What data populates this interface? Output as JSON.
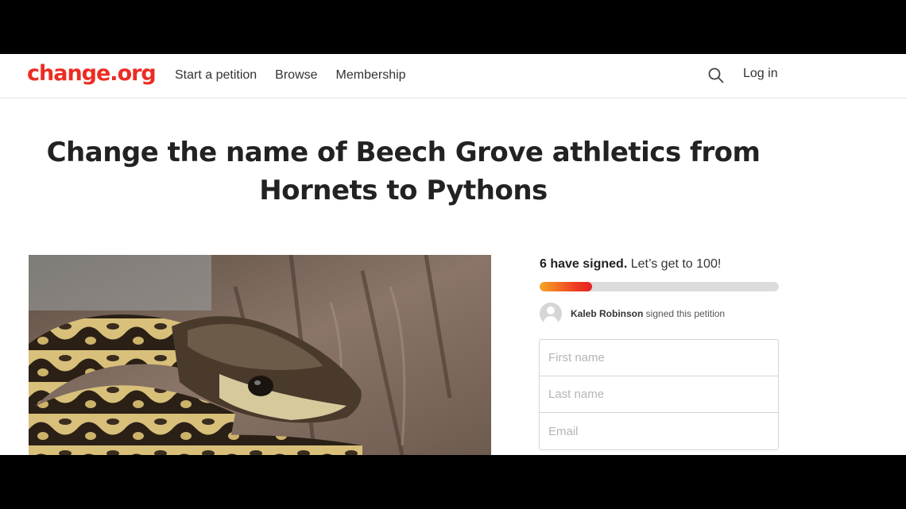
{
  "header": {
    "logo": "change.org",
    "nav": [
      "Start a petition",
      "Browse",
      "Membership"
    ],
    "login": "Log in"
  },
  "petition": {
    "title_line1": "Change the name of Beech Grove athletics from",
    "title_line2": "Hornets to Pythons",
    "image_alt": "python snake"
  },
  "signatures": {
    "count_text": "6 have signed.",
    "goal_text": " Let’s get to 100!",
    "count": 6,
    "goal": 100,
    "progress_fraction": 0.22
  },
  "recent_signer": {
    "name": "Kaleb Robinson",
    "action": " signed this petition"
  },
  "form": {
    "first_name_placeholder": "First name",
    "last_name_placeholder": "Last name",
    "email_placeholder": "Email"
  },
  "colors": {
    "brand": "#ec2c22",
    "progress_start": "#f5a623",
    "progress_end": "#e52121"
  }
}
